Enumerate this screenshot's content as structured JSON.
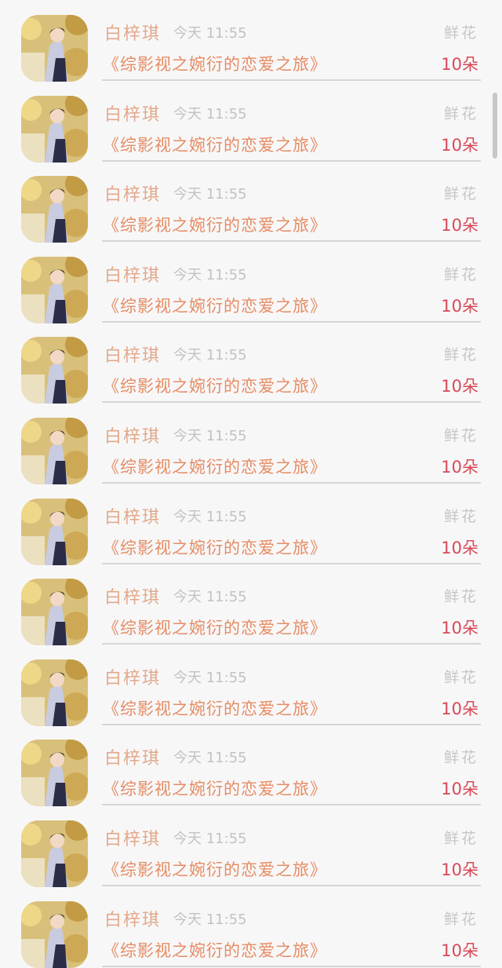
{
  "items": [
    {
      "name": "白梓琪",
      "time": "今天 11:55",
      "gift": "鲜花",
      "title": "《综影视之婉衍的恋爱之旅》",
      "count": "10朵"
    },
    {
      "name": "白梓琪",
      "time": "今天 11:55",
      "gift": "鲜花",
      "title": "《综影视之婉衍的恋爱之旅》",
      "count": "10朵"
    },
    {
      "name": "白梓琪",
      "time": "今天 11:55",
      "gift": "鲜花",
      "title": "《综影视之婉衍的恋爱之旅》",
      "count": "10朵"
    },
    {
      "name": "白梓琪",
      "time": "今天 11:55",
      "gift": "鲜花",
      "title": "《综影视之婉衍的恋爱之旅》",
      "count": "10朵"
    },
    {
      "name": "白梓琪",
      "time": "今天 11:55",
      "gift": "鲜花",
      "title": "《综影视之婉衍的恋爱之旅》",
      "count": "10朵"
    },
    {
      "name": "白梓琪",
      "time": "今天 11:55",
      "gift": "鲜花",
      "title": "《综影视之婉衍的恋爱之旅》",
      "count": "10朵"
    },
    {
      "name": "白梓琪",
      "time": "今天 11:55",
      "gift": "鲜花",
      "title": "《综影视之婉衍的恋爱之旅》",
      "count": "10朵"
    },
    {
      "name": "白梓琪",
      "time": "今天 11:55",
      "gift": "鲜花",
      "title": "《综影视之婉衍的恋爱之旅》",
      "count": "10朵"
    },
    {
      "name": "白梓琪",
      "time": "今天 11:55",
      "gift": "鲜花",
      "title": "《综影视之婉衍的恋爱之旅》",
      "count": "10朵"
    },
    {
      "name": "白梓琪",
      "time": "今天 11:55",
      "gift": "鲜花",
      "title": "《综影视之婉衍的恋爱之旅》",
      "count": "10朵"
    },
    {
      "name": "白梓琪",
      "time": "今天 11:55",
      "gift": "鲜花",
      "title": "《综影视之婉衍的恋爱之旅》",
      "count": "10朵"
    },
    {
      "name": "白梓琪",
      "time": "今天 11:55",
      "gift": "鲜花",
      "title": "《综影视之婉衍的恋爱之旅》",
      "count": "10朵"
    }
  ],
  "colors": {
    "name": "#e1a98a",
    "title": "#e58c63",
    "count": "#d64a58",
    "muted": "#c2c2c2",
    "background": "#f8f7f8"
  }
}
